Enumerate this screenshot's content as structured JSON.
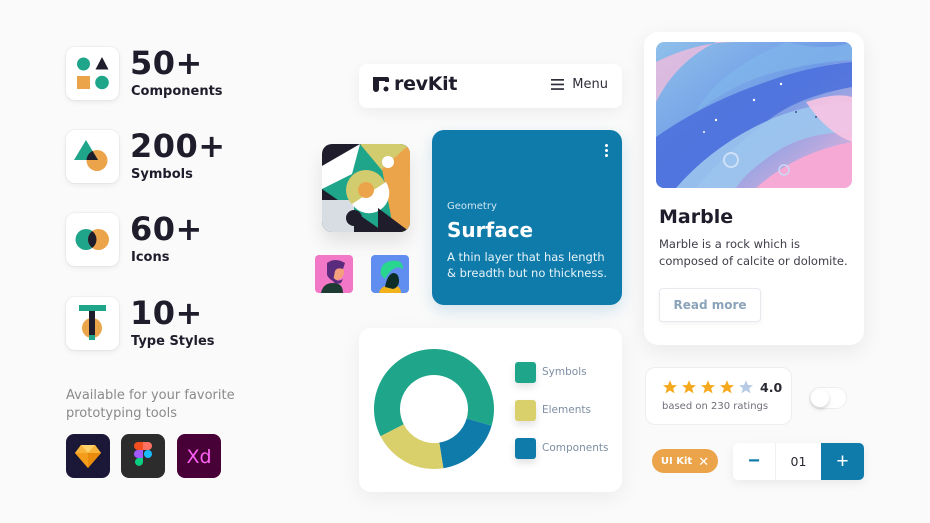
{
  "stats": [
    {
      "value": "50+",
      "label": "Components",
      "icon": "shapes-icon"
    },
    {
      "value": "200+",
      "label": "Symbols",
      "icon": "triangle-circle-icon"
    },
    {
      "value": "60+",
      "label": "Icons",
      "icon": "overlapping-circles-icon"
    },
    {
      "value": "10+",
      "label": "Type Styles",
      "icon": "type-t-icon"
    }
  ],
  "tools": {
    "caption": "Available for your favorite prototyping tools",
    "items": [
      {
        "name": "Sketch",
        "icon": "sketch-icon"
      },
      {
        "name": "Figma",
        "icon": "figma-icon"
      },
      {
        "name": "Adobe XD",
        "icon": "xd-icon",
        "glyph": "Xd"
      }
    ]
  },
  "nav": {
    "brand": "revKit",
    "menu_label": "Menu"
  },
  "surface_card": {
    "eyebrow": "Geometry",
    "title": "Surface",
    "description": "A thin layer that has length & breadth but no thickness."
  },
  "marble_card": {
    "title": "Marble",
    "description": "Marble is a rock which is composed of calcite or dolomite.",
    "button_label": "Read more"
  },
  "chart_data": {
    "type": "pie",
    "variant": "donut",
    "title": "",
    "categories": [
      "Symbols",
      "Components",
      "Elements"
    ],
    "values": [
      62,
      18,
      20
    ],
    "colors": [
      "#1fa58a",
      "#0e7bab",
      "#d9cf6b"
    ],
    "legend": [
      "Symbols",
      "Elements",
      "Components"
    ],
    "legend_colors": [
      "#1fa58a",
      "#d9cf6b",
      "#0e7bab"
    ],
    "legend_position": "right"
  },
  "rating": {
    "value": 4.0,
    "value_label": "4.0",
    "max": 5,
    "subtitle": "based on 230 ratings"
  },
  "toggle": {
    "on": false
  },
  "chip": {
    "label": "UI Kit",
    "close": "✕"
  },
  "stepper": {
    "value": "01",
    "dec": "−",
    "inc": "+"
  },
  "colors": {
    "primary": "#0e7bab",
    "teal": "#1fa58a",
    "orange": "#eca44a",
    "yellow": "#d9cf6b",
    "dark": "#1f1d2b"
  }
}
